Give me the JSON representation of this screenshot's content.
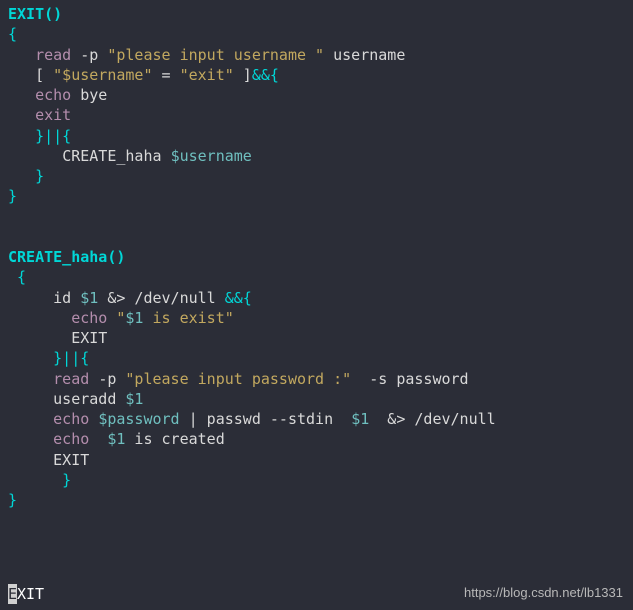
{
  "code": {
    "fn1": "EXIT()",
    "brace_open": "{",
    "l1_read": "read",
    "l1_p": "-p",
    "l1_str": "\"please input username \"",
    "l1_user": " username",
    "l2_bracket": "[ ",
    "l2_var": "\"$username\"",
    "l2_eq": " = ",
    "l2_exit_str": "\"exit\"",
    "l2_tail": " ]",
    "l2_and": "&&{",
    "l3_echo": "echo",
    "l3_bye": " bye",
    "l4_exit": "exit",
    "l5": "}||{",
    "l6_create": "CREATE_haha ",
    "l6_var": "$username",
    "l7": "}",
    "brace_close": "}",
    "fn2": "CREATE_haha()",
    "brace_open2": " {",
    "c1_id": "id ",
    "c1_var": "$1",
    "c1_redir": " &> /dev/null ",
    "c1_and": "&&{",
    "c2_echo": "echo ",
    "c2_str_open": "\"",
    "c2_var": "$1",
    "c2_str_rest": " is exist\"",
    "c3_exit": "EXIT",
    "c4": "}||{",
    "c5_read": "read",
    "c5_p": "-p",
    "c5_str": "\"please input password :\"",
    "c5_s": "  -s password",
    "c6_useradd": "useradd ",
    "c6_var": "$1",
    "c7_echo": "echo ",
    "c7_var1": "$password",
    "c7_pipe": " | passwd --stdin  ",
    "c7_var2": "$1",
    "c7_redir": "  &> /dev/null",
    "c8_echo": "echo  ",
    "c8_var": "$1",
    "c8_rest": " is created",
    "c9_exit": "EXIT",
    "c10": " }",
    "brace_close2": "}",
    "last_line": "XIT",
    "cursor_char": "E"
  },
  "watermark": "https://blog.csdn.net/lb1331"
}
